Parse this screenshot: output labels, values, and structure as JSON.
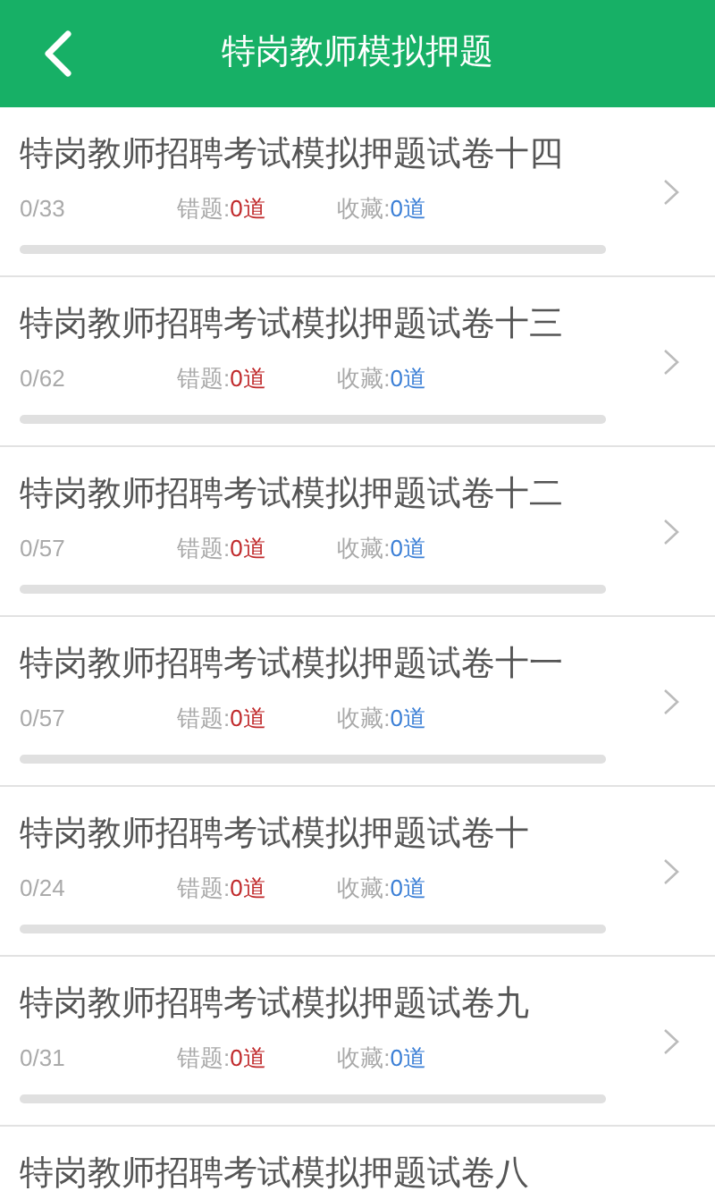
{
  "header": {
    "title": "特岗教师模拟押题"
  },
  "papers": [
    {
      "title": "特岗教师招聘考试模拟押题试卷十四",
      "progress": "0/33",
      "wrong_label": "错题:",
      "wrong_count": "0道",
      "fav_label": "收藏:",
      "fav_count": "0道",
      "level": 0
    },
    {
      "title": "特岗教师招聘考试模拟押题试卷十三",
      "progress": "0/62",
      "wrong_label": "错题:",
      "wrong_count": "0道",
      "fav_label": "收藏:",
      "fav_count": "0道",
      "level": 0
    },
    {
      "title": "特岗教师招聘考试模拟押题试卷十二",
      "progress": "0/57",
      "wrong_label": "错题:",
      "wrong_count": "0道",
      "fav_label": "收藏:",
      "fav_count": "0道",
      "level": 0
    },
    {
      "title": "特岗教师招聘考试模拟押题试卷十一",
      "progress": "0/57",
      "wrong_label": "错题:",
      "wrong_count": "0道",
      "fav_label": "收藏:",
      "fav_count": "0道",
      "level": 0
    },
    {
      "title": "特岗教师招聘考试模拟押题试卷十",
      "progress": "0/24",
      "wrong_label": "错题:",
      "wrong_count": "0道",
      "fav_label": "收藏:",
      "fav_count": "0道",
      "level": 0
    },
    {
      "title": "特岗教师招聘考试模拟押题试卷九",
      "progress": "0/31",
      "wrong_label": "错题:",
      "wrong_count": "0道",
      "fav_label": "收藏:",
      "fav_count": "0道",
      "level": 0
    },
    {
      "title": "特岗教师招聘考试模拟押题试卷八"
    }
  ]
}
